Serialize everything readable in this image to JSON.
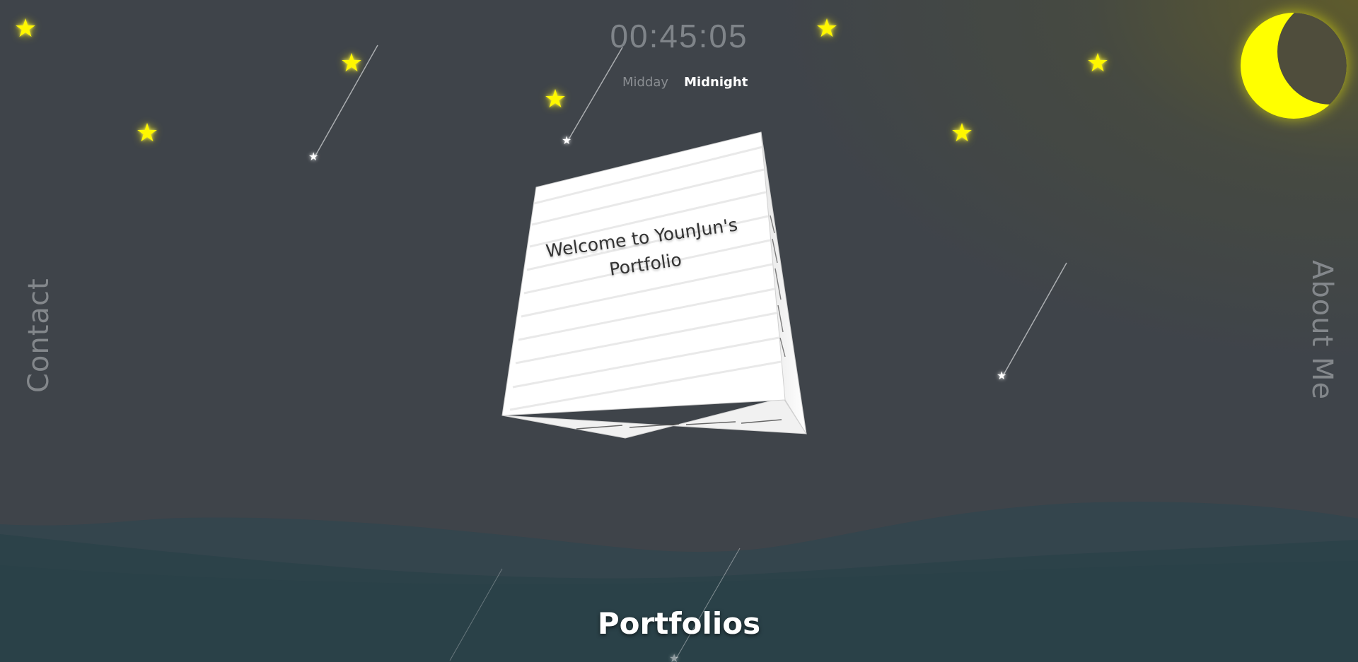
{
  "timer": {
    "display": "00:45:05"
  },
  "mode_toggle": {
    "midday_label": "Midday",
    "midnight_label": "Midnight",
    "active": "Midnight"
  },
  "nav": {
    "contact_label": "Contact",
    "about_label": "About Me",
    "portfolios_label": "Portfolios"
  },
  "cube": {
    "title": "Welcome to YounJun's Portfolio"
  },
  "icons": {
    "star": "star-icon",
    "moon": "moon-icon",
    "shooting_star": "shooting-star-icon"
  },
  "colors": {
    "background": "#3f444a",
    "star": "#fff700",
    "moon": "#ffff00",
    "wave": "#2b444c",
    "cube_face": "#ffffff"
  }
}
